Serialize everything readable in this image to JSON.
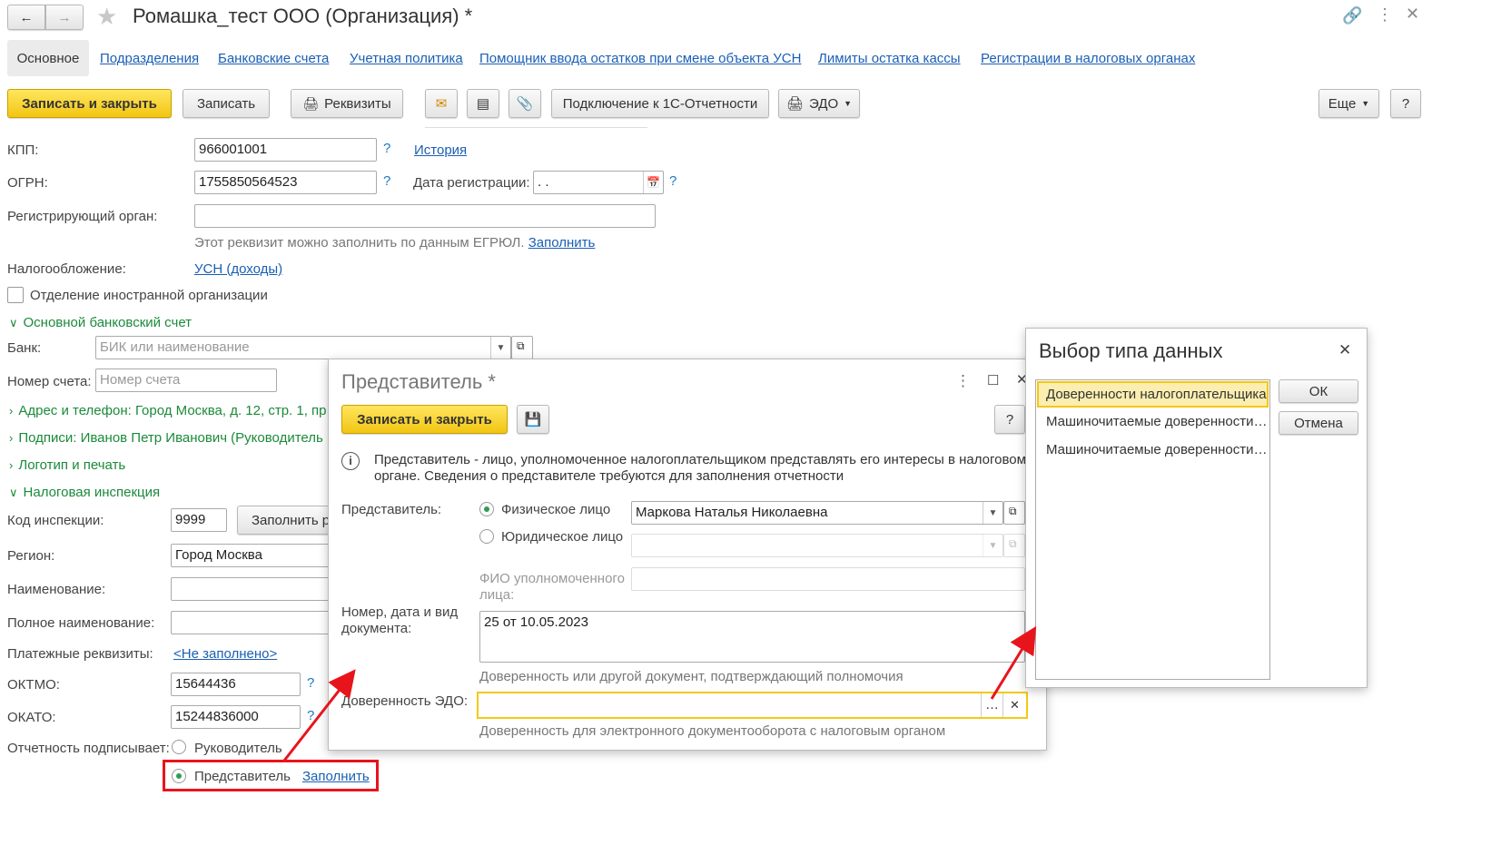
{
  "window": {
    "title": "Ромашка_тест ООО (Организация) *"
  },
  "tabs": [
    "Основное",
    "Подразделения",
    "Банковские счета",
    "Учетная политика",
    "Помощник ввода остатков при смене объекта УСН",
    "Лимиты остатка кассы",
    "Регистрации в налоговых органах"
  ],
  "toolbar": {
    "save_close": "Записать и закрыть",
    "save": "Записать",
    "requisites": "Реквизиты",
    "connect": "Подключение к 1С-Отчетности",
    "edo": "ЭДО",
    "more": "Еще",
    "help": "?"
  },
  "form": {
    "kpp_label": "КПП:",
    "kpp_value": "966001001",
    "history": "История",
    "ogrn_label": "ОГРН:",
    "ogrn_value": "1755850564523",
    "reg_date_label": "Дата регистрации:",
    "reg_date_value": " .  .",
    "reg_organ_label": "Регистрирующий орган:",
    "egrul_hint": "Этот реквизит можно заполнить по данным ЕГРЮЛ.",
    "egrul_fill": "Заполнить",
    "tax_label": "Налогообложение:",
    "tax_value": "УСН (доходы)",
    "foreign_label": "Отделение иностранной организации",
    "bank_section": "Основной банковский счет",
    "bank_label": "Банк:",
    "bank_placeholder": "БИК или наименование",
    "account_label": "Номер счета:",
    "account_placeholder": "Номер счета",
    "address_section": "Адрес и телефон: Город Москва, д. 12, стр. 1, пр",
    "signatures_section": "Подписи: Иванов Петр Иванович (Руководитель",
    "logo_section": "Логотип и печать",
    "tax_office_section": "Налоговая инспекция",
    "ifns_code_label": "Код инспекции:",
    "ifns_code_value": "9999",
    "fill_req": "Заполнить р",
    "region_label": "Регион:",
    "region_value": "Город Москва",
    "name_label": "Наименование:",
    "fullname_label": "Полное наименование:",
    "payment_label": "Платежные реквизиты:",
    "payment_value": "<Не заполнено>",
    "oktmo_label": "ОКТМО:",
    "oktmo_value": "15644436",
    "okato_label": "ОКАТО:",
    "okato_value": "15244836000",
    "signs_label": "Отчетность подписывает:",
    "signs_head": "Руководитель",
    "signs_rep": "Представитель",
    "signs_fill": "Заполнить"
  },
  "rep_dialog": {
    "title": "Представитель *",
    "save_close": "Записать и закрыть",
    "help": "?",
    "info": "Представитель - лицо, уполномоченное налогоплательщиком представлять его интересы в налоговом органе. Сведения о представителе требуются для заполнения отчетности",
    "rep_label": "Представитель:",
    "individual": "Физическое лицо",
    "individual_value": "Маркова Наталья Николаевна",
    "legal": "Юридическое лицо",
    "fio_label": "ФИО уполномоченного лица:",
    "doc_label": "Номер, дата и вид документа:",
    "doc_value": "25 от 10.05.2023",
    "doc_hint": "Доверенность или другой документ, подтверждающий полномочия",
    "edo_label": "Доверенность ЭДО:",
    "edo_hint": "Доверенность для электронного документооборота с налоговым органом"
  },
  "type_dialog": {
    "title": "Выбор типа данных",
    "items": [
      "Доверенности налогоплательщика",
      "Машиночитаемые доверенности…",
      "Машиночитаемые доверенности…"
    ],
    "ok": "ОК",
    "cancel": "Отмена"
  },
  "colors": {
    "accent_yellow": "#f5c813",
    "link": "#1a5fb4",
    "section_green": "#1b8a3a",
    "annotation_red": "#e8141c"
  }
}
